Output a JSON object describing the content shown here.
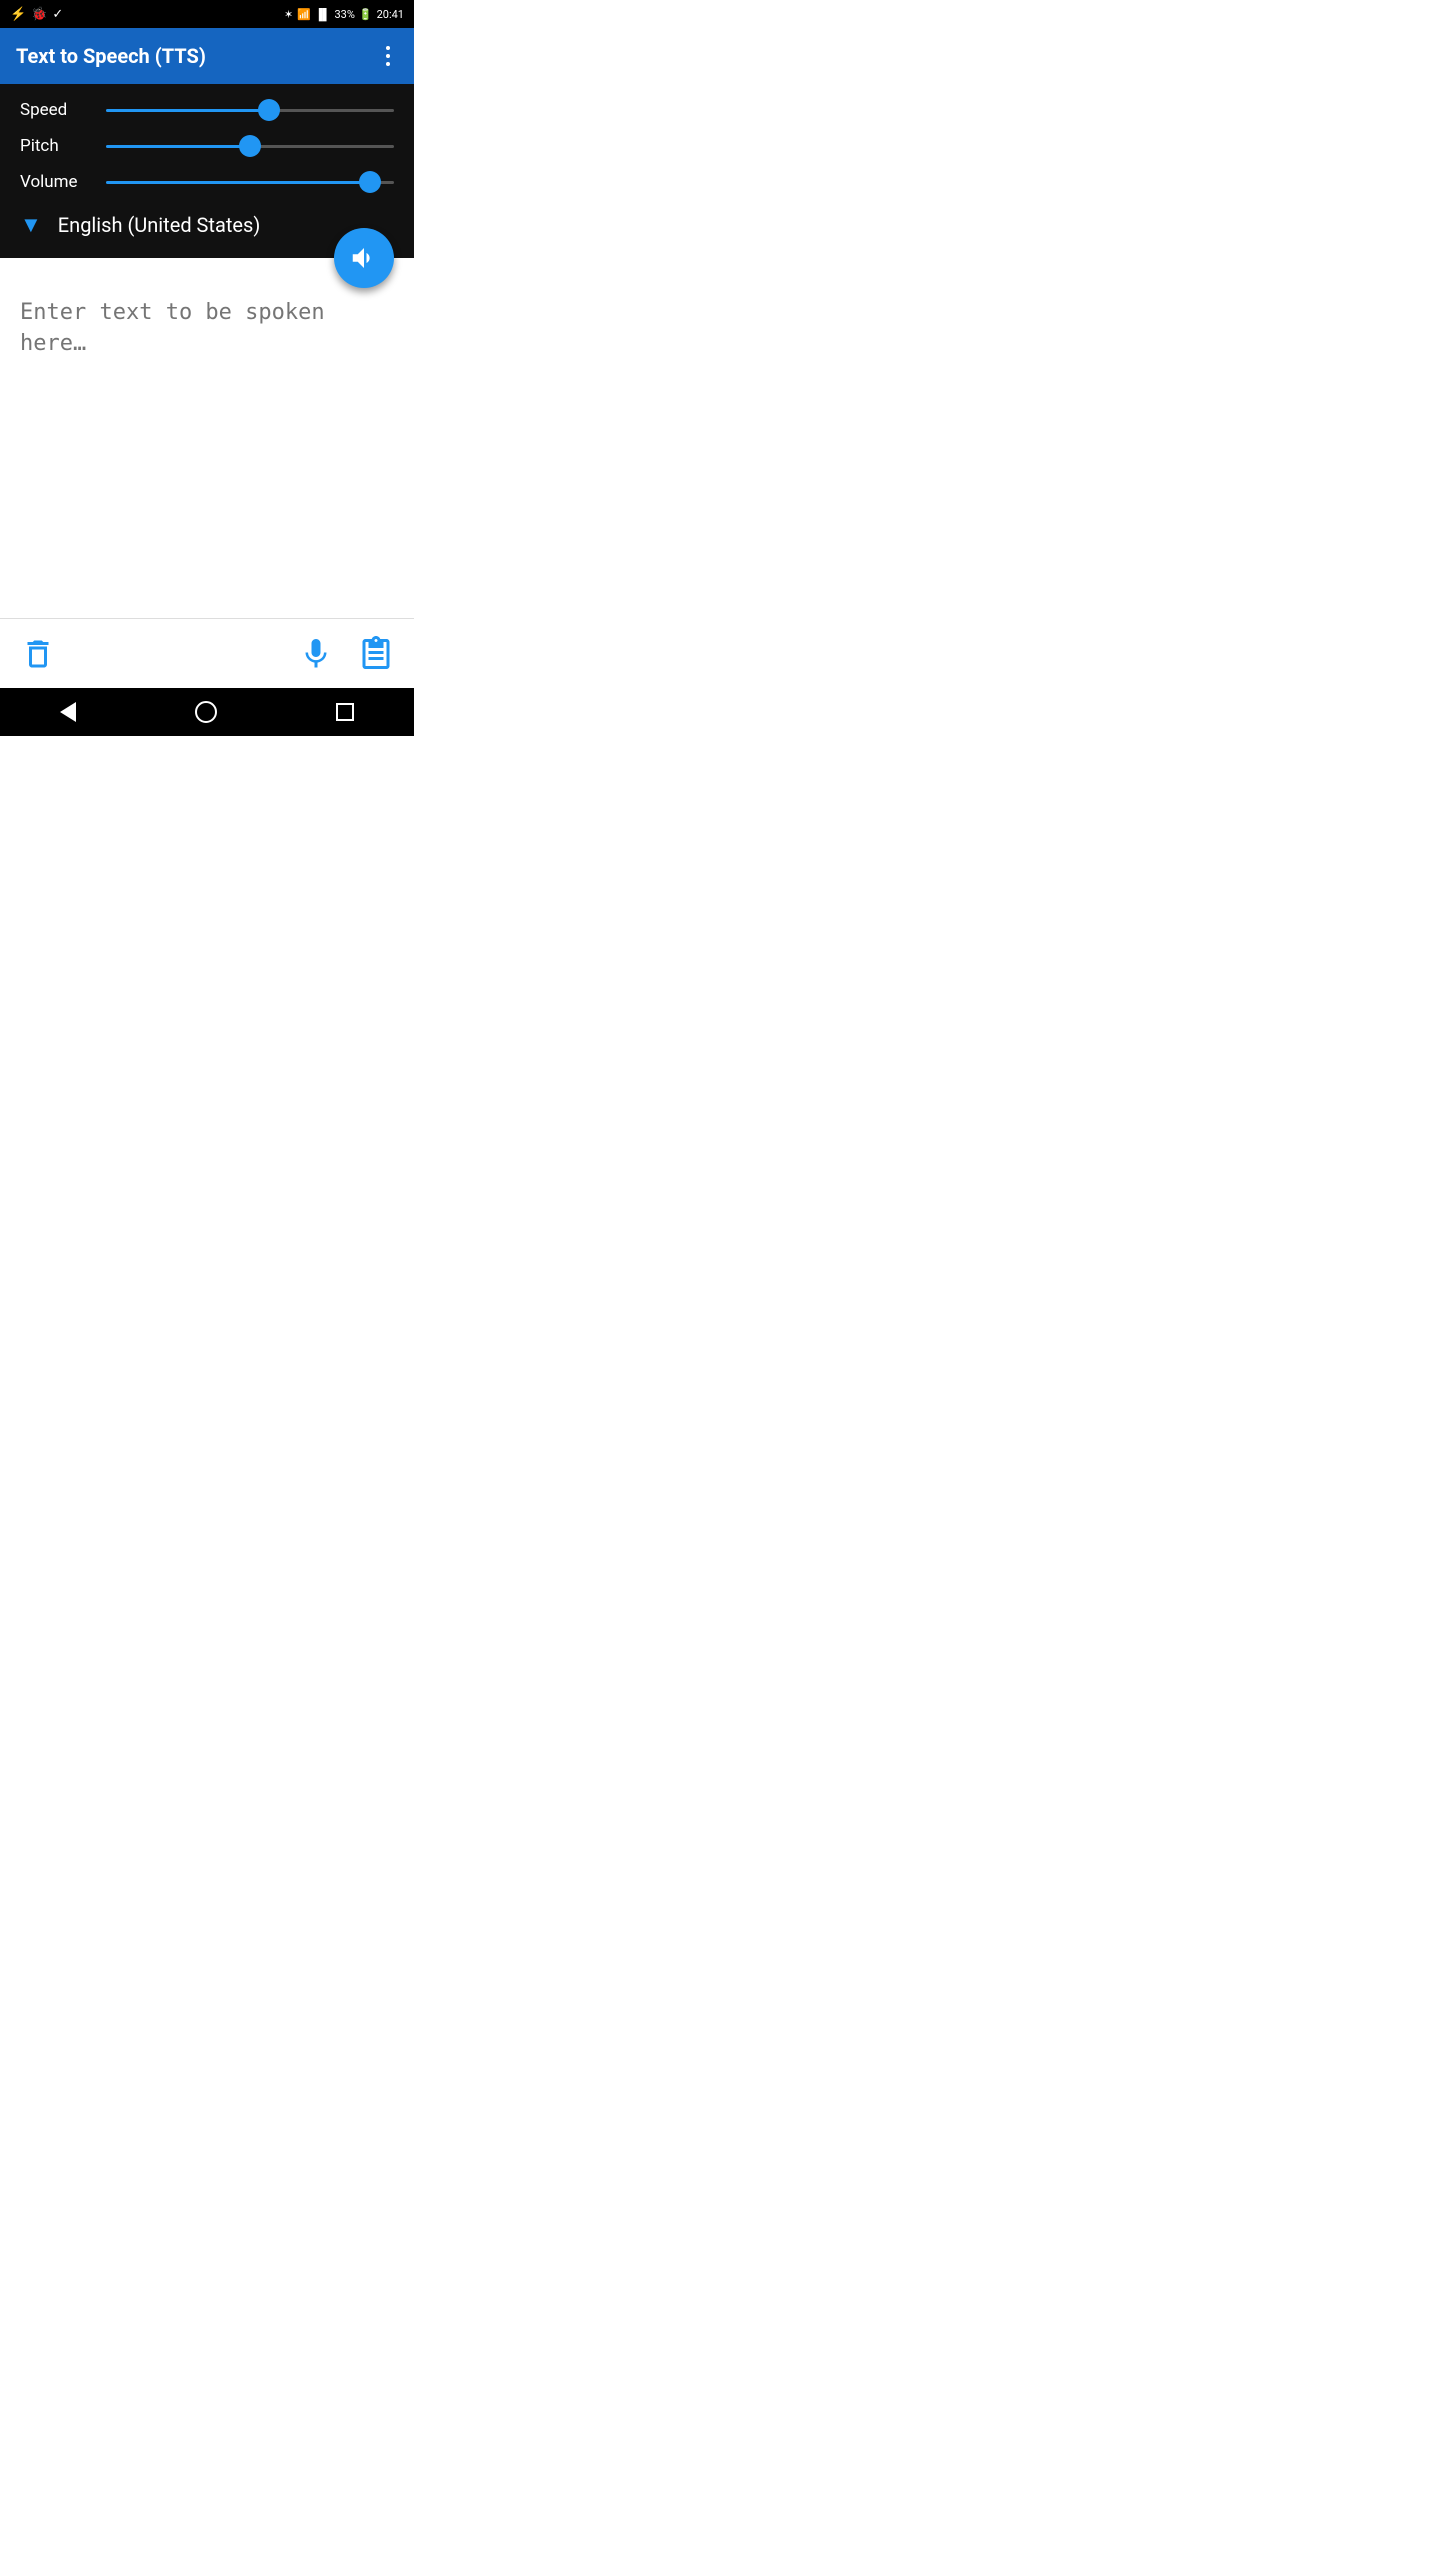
{
  "status_bar": {
    "time": "20:41",
    "battery": "33%",
    "icons_left": [
      "usb",
      "bug",
      "check"
    ],
    "icons_right": [
      "bluetooth",
      "wifi",
      "signal",
      "battery",
      "time"
    ]
  },
  "app_bar": {
    "title": "Text to Speech (TTS)",
    "overflow_menu_label": "More options"
  },
  "controls": {
    "speed_label": "Speed",
    "speed_value": 57,
    "pitch_label": "Pitch",
    "pitch_value": 50,
    "volume_label": "Volume",
    "volume_value": 95
  },
  "language": {
    "selected": "English (United States)",
    "arrow": "▼"
  },
  "fab": {
    "label": "Speak"
  },
  "text_input": {
    "placeholder": "Enter text to be spoken here…",
    "value": ""
  },
  "bottom_toolbar": {
    "clear_label": "Clear",
    "mic_label": "Microphone",
    "paste_label": "Paste"
  },
  "nav_bar": {
    "back_label": "Back",
    "home_label": "Home",
    "recents_label": "Recents"
  }
}
